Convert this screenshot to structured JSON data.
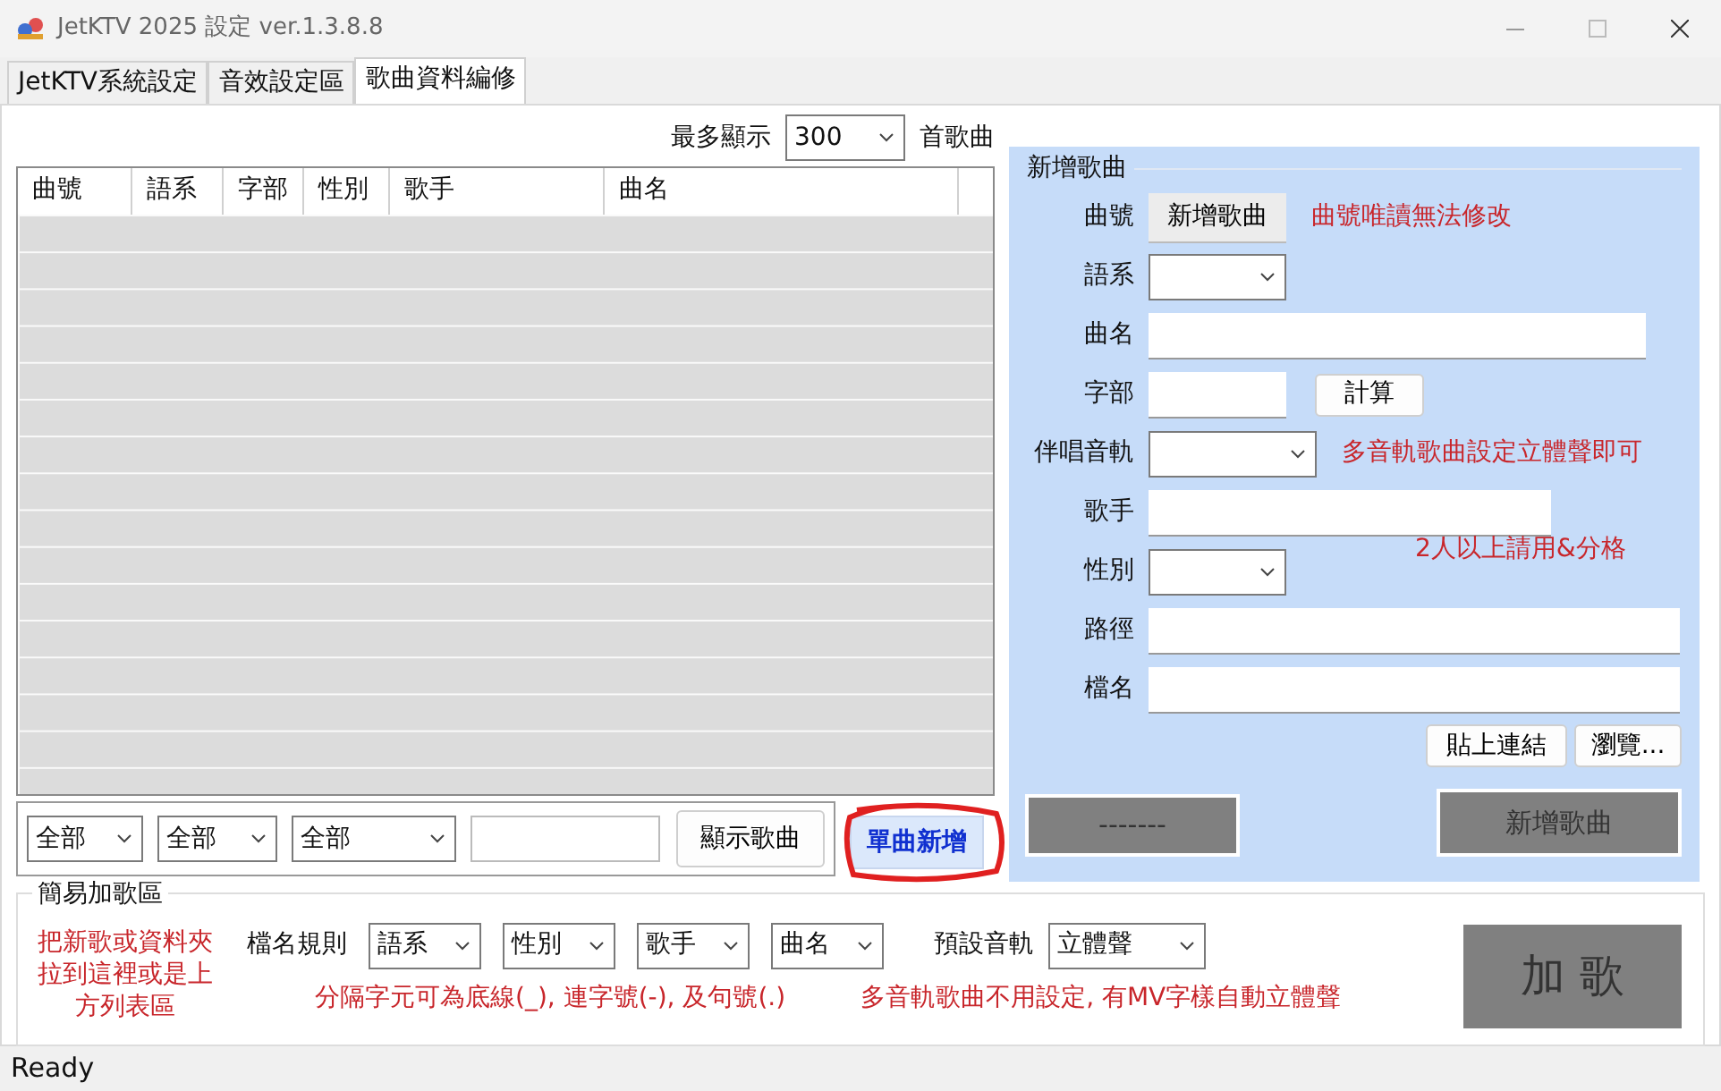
{
  "window": {
    "title": "JetKTV 2025 設定 ver.1.3.8.8"
  },
  "tabs": [
    {
      "label": "JetKTV系統設定",
      "selected": false
    },
    {
      "label": "音效設定區",
      "selected": false
    },
    {
      "label": "歌曲資料編修",
      "selected": true
    }
  ],
  "song_list": {
    "max_display_label": "最多顯示",
    "max_display_value": "300",
    "max_display_suffix": "首歌曲",
    "columns": [
      "曲號",
      "語系",
      "字部",
      "性別",
      "歌手",
      "曲名"
    ],
    "filters": [
      {
        "kind": "combo",
        "value": "全部"
      },
      {
        "kind": "combo",
        "value": "全部"
      },
      {
        "kind": "combo",
        "value": "全部"
      },
      {
        "kind": "text"
      }
    ],
    "show_button": "顯示歌曲"
  },
  "single_add_button": {
    "label": "單曲新增",
    "circled": true
  },
  "add_song_panel": {
    "title": "新增歌曲",
    "fields": [
      {
        "label": "曲號",
        "kind": "button",
        "value": "新增歌曲",
        "note": "曲號唯讀無法修改"
      },
      {
        "label": "語系",
        "kind": "combo"
      },
      {
        "label": "曲名",
        "kind": "text"
      },
      {
        "label": "字部",
        "kind": "text",
        "button": "計算"
      },
      {
        "label": "伴唱音軌",
        "kind": "combo",
        "note": "多音軌歌曲設定立體聲即可"
      },
      {
        "label": "歌手",
        "kind": "text"
      },
      {
        "label": "性別",
        "kind": "combo",
        "note": "2人以上請用&分格"
      },
      {
        "label": "路徑",
        "kind": "text"
      },
      {
        "label": "檔名",
        "kind": "text"
      }
    ],
    "link_buttons": [
      "貼上連結",
      "瀏覽..."
    ],
    "left_button": "-------",
    "submit_button": "新增歌曲"
  },
  "easy_add": {
    "title": "簡易加歌區",
    "drop_hint": "把新歌或資料夾拉到這裡或是上方列表區",
    "naming_label": "檔名規則",
    "naming_combos": [
      "語系",
      "性別",
      "歌手",
      "曲名"
    ],
    "separator_hint": "分隔字元可為底線(_), 連字號(-), 及句號(.)",
    "track_label": "預設音軌",
    "track_value": "立體聲",
    "track_hint": "多音軌歌曲不用設定, 有MV字樣自動立體聲",
    "add_button": "加 歌"
  },
  "status_bar": "Ready"
}
